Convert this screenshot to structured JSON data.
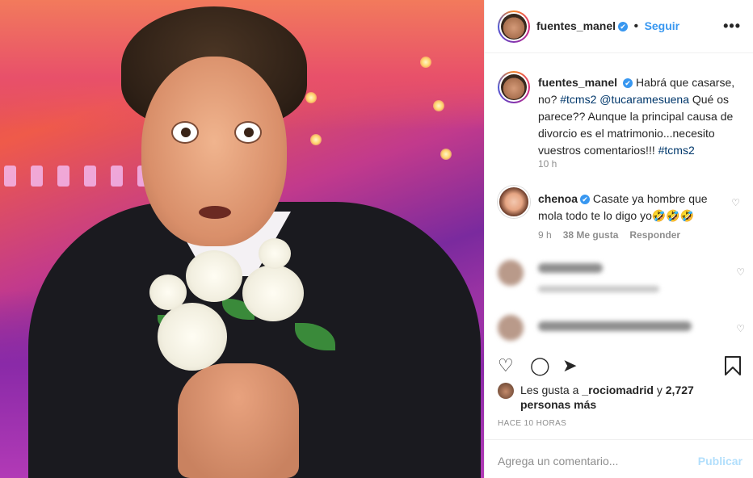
{
  "post": {
    "author": "fuentes_manel",
    "follow_label": "Seguir",
    "separator": "•",
    "more_label": "•••"
  },
  "caption": {
    "username": "fuentes_manel",
    "text_a": "Habrá que casarse, no?",
    "tag1": "#tcms2",
    "mention": "@tucaramesuena",
    "text_b": "Qué os parece?? Aunque la principal causa de divorcio es el matrimonio...necesito vuestros comentarios!!!",
    "tag2": "#tcms2",
    "time": "10 h"
  },
  "comments": [
    {
      "username": "chenoa",
      "text": "Casate ya hombre que mola todo te lo digo yo🤣🤣🤣",
      "time": "9 h",
      "likes": "38 Me gusta",
      "reply": "Responder",
      "heart": "♡"
    }
  ],
  "likes": {
    "prefix": "Les gusta a",
    "user": "_rociomadrid",
    "joiner": "y",
    "others": "2,727 personas más"
  },
  "ago": "HACE 10 HORAS",
  "add_comment": {
    "placeholder": "Agrega un comentario...",
    "publish": "Publicar"
  },
  "icons": {
    "verified": "✔",
    "heart": "♡",
    "like_action": "♡",
    "comment_action": "◯",
    "share_action": "➤"
  }
}
